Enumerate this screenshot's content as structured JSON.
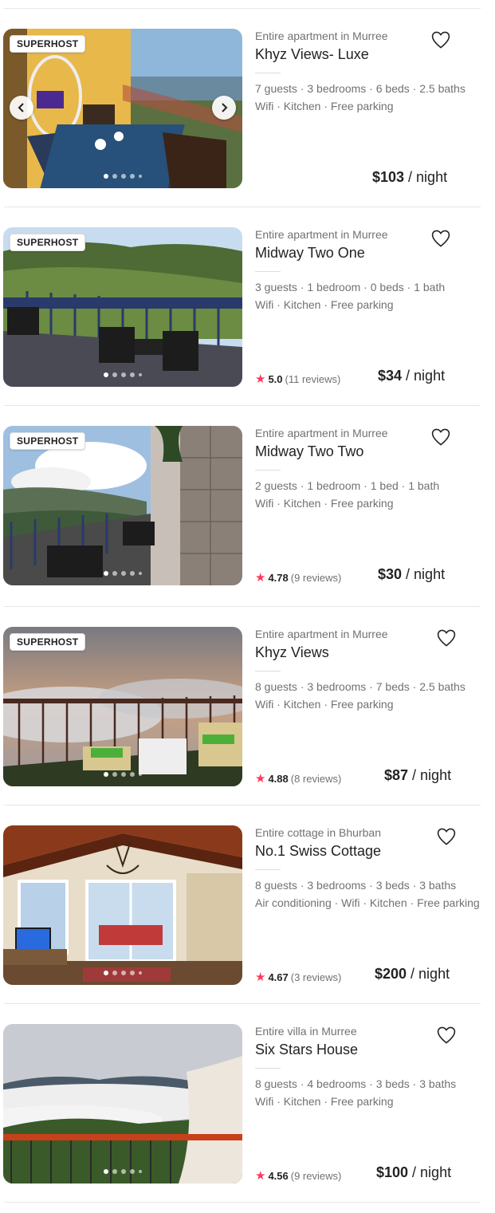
{
  "listings": [
    {
      "superhost": "SUPERHOST",
      "subtitle": "Entire apartment in Murree",
      "title": "Khyz Views- Luxe",
      "details": "7 guests · 3 bedrooms · 6 beds · 2.5 baths",
      "amenities": "Wifi · Kitchen · Free parking",
      "rating": "",
      "reviews": "",
      "price": "$103",
      "per": " / night",
      "wishlist_icon": "heart-icon",
      "photo_count": 5,
      "active_photo": 1
    },
    {
      "superhost": "SUPERHOST",
      "subtitle": "Entire apartment in Murree",
      "title": "Midway Two One",
      "details": "3 guests · 1 bedroom · 0 beds · 1 bath",
      "amenities": "Wifi · Kitchen · Free parking",
      "rating": "5.0",
      "reviews": "(11 reviews)",
      "price": "$34",
      "per": " / night",
      "wishlist_icon": "heart-icon",
      "photo_count": 5,
      "active_photo": 1
    },
    {
      "superhost": "SUPERHOST",
      "subtitle": "Entire apartment in Murree",
      "title": "Midway Two Two",
      "details": "2 guests · 1 bedroom · 1 bed · 1 bath",
      "amenities": "Wifi · Kitchen · Free parking",
      "rating": "4.78",
      "reviews": "(9 reviews)",
      "price": "$30",
      "per": " / night",
      "wishlist_icon": "heart-icon",
      "photo_count": 5,
      "active_photo": 1
    },
    {
      "superhost": "SUPERHOST",
      "subtitle": "Entire apartment in Murree",
      "title": "Khyz Views",
      "details": "8 guests · 3 bedrooms · 7 beds · 2.5 baths",
      "amenities": "Wifi · Kitchen · Free parking",
      "rating": "4.88",
      "reviews": "(8 reviews)",
      "price": "$87",
      "per": " / night",
      "wishlist_icon": "heart-icon",
      "photo_count": 5,
      "active_photo": 1
    },
    {
      "superhost": "",
      "subtitle": "Entire cottage in Bhurban",
      "title": "No.1 Swiss Cottage",
      "details": "8 guests · 3 bedrooms · 3 beds · 3 baths",
      "amenities": "Air conditioning · Wifi · Kitchen · Free parking",
      "rating": "4.67",
      "reviews": "(3 reviews)",
      "price": "$200",
      "per": " / night",
      "wishlist_icon": "heart-icon",
      "photo_count": 5,
      "active_photo": 1
    },
    {
      "superhost": "",
      "subtitle": "Entire villa in Murree",
      "title": "Six Stars House",
      "details": "8 guests · 4 bedrooms · 3 beds · 3 baths",
      "amenities": "Wifi · Kitchen · Free parking",
      "rating": "4.56",
      "reviews": "(9 reviews)",
      "price": "$100",
      "per": " / night",
      "wishlist_icon": "heart-icon",
      "photo_count": 5,
      "active_photo": 1
    }
  ],
  "first_listing_nav": {
    "prev_icon": "chevron-left-icon",
    "next_icon": "chevron-right-icon"
  },
  "colors": {
    "star": "#ff385c",
    "muted": "#717171",
    "text": "#222222"
  }
}
